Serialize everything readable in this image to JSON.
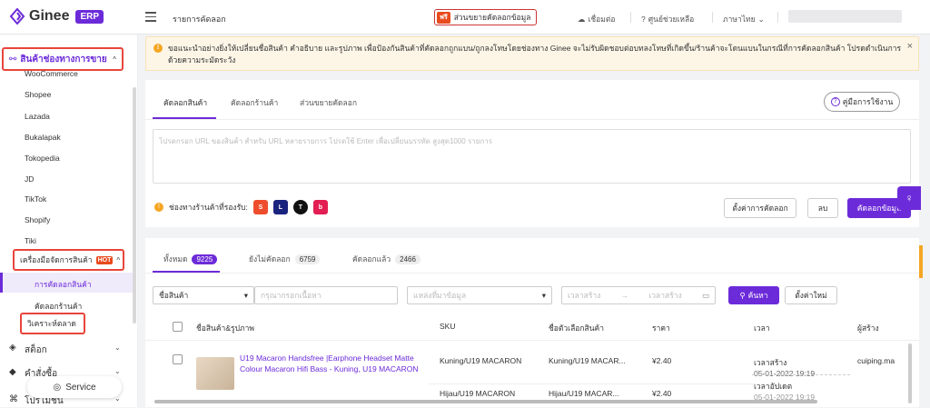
{
  "app": {
    "logo_text": "Ginee",
    "badge": "ERP"
  },
  "header": {
    "page_title": "รายการคัดลอก",
    "promo_badge": "ฟรี",
    "promo_text": "ส่วนขยายคัดลอกข้อมูล",
    "connect": "เชื่อมต่อ",
    "help": "ศูนย์ช่วยเหลือ",
    "language": "ภาษาไทย"
  },
  "sidebar": {
    "channel_products": "สินค้าช่องทางการขาย",
    "channels": [
      "WooCommerce",
      "Shopee",
      "Lazada",
      "Bukalapak",
      "Tokopedia",
      "JD",
      "TikTok",
      "Shopify",
      "Tiki"
    ],
    "tools_group": "เครื่องมือจัดการสินค้า",
    "hot": "HOT",
    "copy_products": "การคัดลอกสินค้า",
    "copy_store": "คัดลอกร้านค้า",
    "market_analysis": "วิเคราะห์ตลาด",
    "stock": "สต็อก",
    "orders": "คำสั่งซื้อ",
    "promotions": "โปรโมชั่น",
    "service": "Service"
  },
  "banner": {
    "text": "ขอแนะนำอย่างยิ่งให้เปลี่ยนชื่อสินค้า คำอธิบาย และรูปภาพ เพื่อป้องกันสินค้าที่คัดลอกถูกแบน/ถูกลงโทษโดยช่องทาง Ginee จะไม่รับผิดชอบต่อบทลงโทษที่เกิดขึ้น/ร้านค้าจะโดนแบนในกรณีที่การคัดลอกสินค้า โปรดดำเนินการด้วยความระมัดระวัง"
  },
  "copy_card": {
    "tabs": [
      "คัดลอกสินค้า",
      "คัดลอกร้านค้า",
      "ส่วนขยายคัดลอก"
    ],
    "guide": "คู่มือการใช้งาน",
    "url_placeholder": "โปรดกรอก URL ของสินค้า สำหรับ URL หลายรายการ โปรดใช้ Enter เพื่อเปลี่ยนบรรทัด สูงสุด1000 รายการ",
    "supported_channels": "ช่องทางร้านค้าที่รองรับ:",
    "settings_button": "ตั้งค่าการคัดลอก",
    "delete_button": "ลบ",
    "copy_button": "คัดลอกข้อมูล"
  },
  "list_card": {
    "tabs": [
      {
        "label": "ทั้งหมด",
        "count": "9225"
      },
      {
        "label": "ยังไม่คัดลอก",
        "count": "6759"
      },
      {
        "label": "คัดลอกแล้ว",
        "count": "2466"
      }
    ],
    "filter_field": "ชื่อสินค้า",
    "search_placeholder": "กรุณากรอกเนื้อหา",
    "source_placeholder": "แหล่งที่มาข้อมูล",
    "date_from": "เวลาสร้าง",
    "date_to": "เวลาสร้าง",
    "search_button": "ค้นหา",
    "reset_button": "ตั้งค่าใหม่",
    "columns": [
      "ชื่อสินค้า&รูปภาพ",
      "SKU",
      "ชื่อตัวเลือกสินค้า",
      "ราคา",
      "เวลา",
      "ผู้สร้าง"
    ],
    "row": {
      "name": "U19 Macaron Handsfree |Earphone Headset Matte Colour Macaron Hifi Bass - Kuning, U19 MACARON",
      "sku1": "Kuning/U19 MACARON",
      "variant1": "Kuning/U19 MACAR...",
      "price1": "¥2.40",
      "created_label": "เวลาสร้าง",
      "created_time": "05-01-2022 19:19",
      "updated_label": "เวลาอัปเดต",
      "updated_time": "05-01-2022 19:19",
      "creator": "cuiping.ma",
      "sku2": "Hijau/U19 MACARON",
      "variant2": "Hijau/U19 MACAR...",
      "price2": "¥2.40"
    }
  },
  "colors": {
    "accent": "#6c2bd9",
    "highlight": "#e8453c",
    "warning": "#f5a623"
  }
}
